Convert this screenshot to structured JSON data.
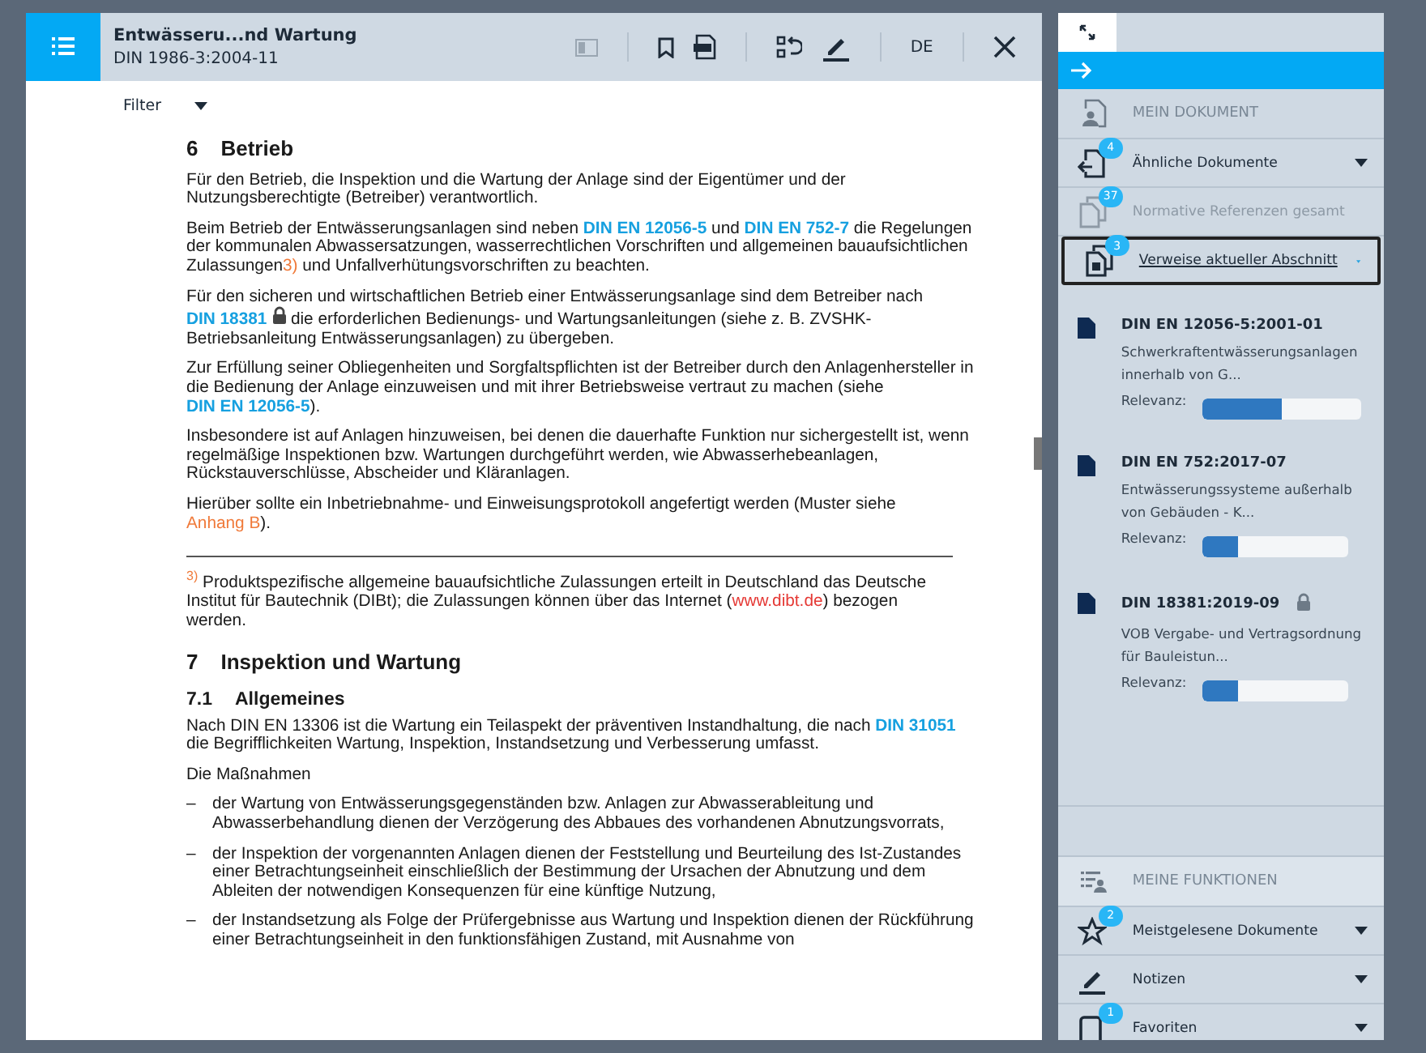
{
  "header": {
    "title": "Entwässeru...nd Wartung",
    "subtitle": "DIN 1986-3:2004-11",
    "language": "DE"
  },
  "filter": {
    "label": "Filter"
  },
  "document": [
    {
      "kind": "heading",
      "number": "6",
      "title": "Betrieb"
    },
    {
      "kind": "paragraph",
      "segments": [
        {
          "kind": "text",
          "text": "Für den Betrieb, die Inspektion und die Wartung der Anlage sind der Eigentümer und der Nutzungsberechtigte (Betreiber) verantwortlich."
        }
      ]
    },
    {
      "kind": "paragraph",
      "segments": [
        {
          "kind": "text",
          "text": "Beim Betrieb der Entwässerungsanlagen sind neben "
        },
        {
          "kind": "link",
          "text": "DIN EN 12056-5"
        },
        {
          "kind": "text",
          "text": " und "
        },
        {
          "kind": "link",
          "text": "DIN EN 752-7"
        },
        {
          "kind": "text",
          "text": " die Regelungen der kommunalen Abwassersatzungen, wasserrechtlichen Vorschriften und allgemeinen bauaufsichtlichen Zulassungen"
        },
        {
          "kind": "note",
          "text": "3)"
        },
        {
          "kind": "text",
          "text": " und Unfallverhütungsvorschriften zu beachten."
        }
      ]
    },
    {
      "kind": "paragraph",
      "segments": [
        {
          "kind": "text",
          "text": "Für den sicheren und wirtschaftlichen Betrieb einer Entwässerungsanlage sind dem Betreiber nach "
        },
        {
          "kind": "link",
          "text": "DIN 18381"
        },
        {
          "kind": "lock"
        },
        {
          "kind": "text",
          "text": " die erforderlichen Bedienungs- und Wartungsanleitungen (siehe z. B. ZVSHK-Betriebsanleitung Entwässerungsanlagen) zu übergeben."
        }
      ]
    },
    {
      "kind": "paragraph",
      "segments": [
        {
          "kind": "text",
          "text": "Zur Erfüllung seiner Obliegenheiten und Sorgfaltspflichten ist der Betreiber durch den Anlagenhersteller in die Bedienung der Anlage einzuweisen und mit ihrer Betriebsweise vertraut zu machen (siehe "
        },
        {
          "kind": "link",
          "text": "DIN EN 12056-5"
        },
        {
          "kind": "text",
          "text": ")."
        }
      ]
    },
    {
      "kind": "paragraph",
      "segments": [
        {
          "kind": "text",
          "text": "Insbesondere ist auf Anlagen hinzuweisen, bei denen die dauerhafte Funktion nur sichergestellt ist, wenn regelmäßige Inspektionen bzw. Wartungen durchgeführt werden, wie Abwasserhebeanlagen, Rückstauverschlüsse, Abscheider und Kläranlagen."
        }
      ]
    },
    {
      "kind": "paragraph",
      "segments": [
        {
          "kind": "text",
          "text": "Hierüber sollte ein Inbetriebnahme- und Einweisungsprotokoll angefertigt werden (Muster siehe "
        },
        {
          "kind": "note",
          "text": "Anhang B"
        },
        {
          "kind": "text",
          "text": ")."
        }
      ]
    },
    {
      "kind": "footnote",
      "mark": "3)",
      "segments": [
        {
          "kind": "text",
          "text": " Produktspezifische allgemeine bauaufsichtliche Zulassungen erteilt in Deutschland das Deutsche Institut für Bautechnik (DIBt); die Zulassungen können über das Internet ("
        },
        {
          "kind": "url",
          "text": "www.dibt.de"
        },
        {
          "kind": "text",
          "text": ") bezogen werden."
        }
      ]
    },
    {
      "kind": "heading",
      "number": "7",
      "title": "Inspektion und Wartung"
    },
    {
      "kind": "subheading",
      "number": "7.1",
      "title": "Allgemeines"
    },
    {
      "kind": "paragraph",
      "segments": [
        {
          "kind": "text",
          "text": "Nach DIN EN 13306 ist die Wartung ein Teilaspekt der präventiven Instandhaltung, die nach "
        },
        {
          "kind": "link",
          "text": "DIN 31051"
        },
        {
          "kind": "text",
          "text": " die Begrifflichkeiten Wartung, Inspektion, Instandsetzung und Verbesserung umfasst."
        }
      ]
    },
    {
      "kind": "paragraph",
      "segments": [
        {
          "kind": "text",
          "text": "Die Maßnahmen"
        }
      ]
    },
    {
      "kind": "list_item",
      "dash": "–",
      "segments": [
        {
          "kind": "text",
          "text": "der Wartung von Entwässerungsgegenständen bzw. Anlagen zur Abwasserableitung und Abwasserbehandlung dienen der Verzögerung des Abbaues des vorhandenen Abnutzungsvorrats,"
        }
      ]
    },
    {
      "kind": "list_item",
      "dash": "–",
      "segments": [
        {
          "kind": "text",
          "text": "der Inspektion der vorgenannten Anlagen dienen der Feststellung und Beurteilung des Ist-Zustandes einer Betrachtungseinheit einschließlich der Bestimmung der Ursachen der Abnutzung und dem Ableiten der notwendigen Konsequenzen für eine künftige Nutzung,"
        }
      ]
    },
    {
      "kind": "list_item",
      "dash": "–",
      "segments": [
        {
          "kind": "text",
          "text": "der Instandsetzung als Folge der Prüfergebnisse aus Wartung und Inspektion dienen der Rückführung einer Betrachtungseinheit in den funktionsfähigen Zustand, mit Ausnahme von"
        }
      ]
    }
  ],
  "sidebar": {
    "section_title": "MEIN DOKUMENT",
    "items": [
      {
        "label": "Ähnliche Dokumente",
        "badge": "4",
        "kind": "import",
        "disabled": false,
        "selected": false
      },
      {
        "label": "Normative Referenzen gesamt",
        "badge": "37",
        "kind": "copies",
        "disabled": true,
        "selected": false
      },
      {
        "label": "Verweise aktueller Abschnitt",
        "badge": "3",
        "kind": "copies-dark",
        "disabled": false,
        "selected": true
      }
    ],
    "results": [
      {
        "title": "DIN EN 12056-5:2001-01",
        "description": "Schwerkraftentwässerungsanlagen innerhalb von G...",
        "locked": false,
        "relevance_label": "Relevanz:",
        "level": 0.5
      },
      {
        "title": "DIN EN 752:2017-07",
        "description": "Entwässerungssysteme außerhalb von Gebäuden - K...",
        "locked": false,
        "relevance_label": "Relevanz:",
        "level": 0.24
      },
      {
        "title": "DIN 18381:2019-09",
        "description": "VOB Vergabe- und Vertragsordnung für Bauleistun...",
        "locked": true,
        "relevance_label": "Relevanz:",
        "level": 0.24
      }
    ],
    "functions_title": "MEINE FUNKTIONEN",
    "functions": [
      {
        "label": "Meistgelesene Dokumente",
        "badge": "2",
        "kind": "star"
      },
      {
        "label": "Notizen",
        "kind": "pen"
      },
      {
        "label": "Favoriten",
        "badge": "1",
        "kind": "phone"
      }
    ]
  }
}
